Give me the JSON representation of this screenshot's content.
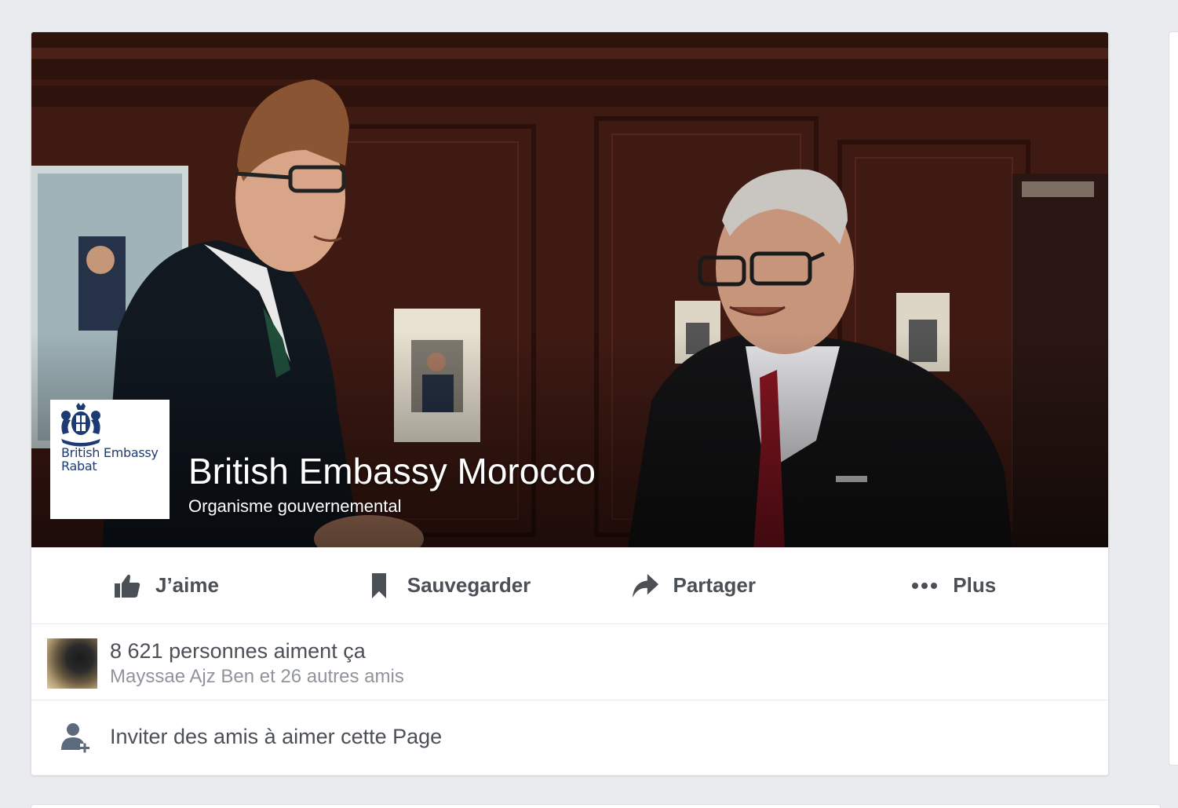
{
  "page": {
    "name": "British Embassy Morocco",
    "category": "Organisme gouvernemental",
    "logo_text_line1": "British Embassy",
    "logo_text_line2": "Rabat"
  },
  "actions": [
    {
      "label": "J’aime",
      "icon": "thumbs-up-icon"
    },
    {
      "label": "Sauvegarder",
      "icon": "bookmark-icon"
    },
    {
      "label": "Partager",
      "icon": "share-arrow-icon"
    },
    {
      "label": "Plus",
      "icon": "more-dots-icon"
    }
  ],
  "likes": {
    "count_text": "8 621 personnes aiment ça",
    "friends_text": "Mayssae Ajz Ben et 26 autres amis"
  },
  "invite": {
    "text": "Inviter des amis à aimer cette Page",
    "icon": "add-friend-icon"
  },
  "colors": {
    "page_bg": "#e9ebee",
    "action_text": "#4b4f56",
    "muted_text": "#90949c",
    "logo_blue": "#1d3b73"
  }
}
